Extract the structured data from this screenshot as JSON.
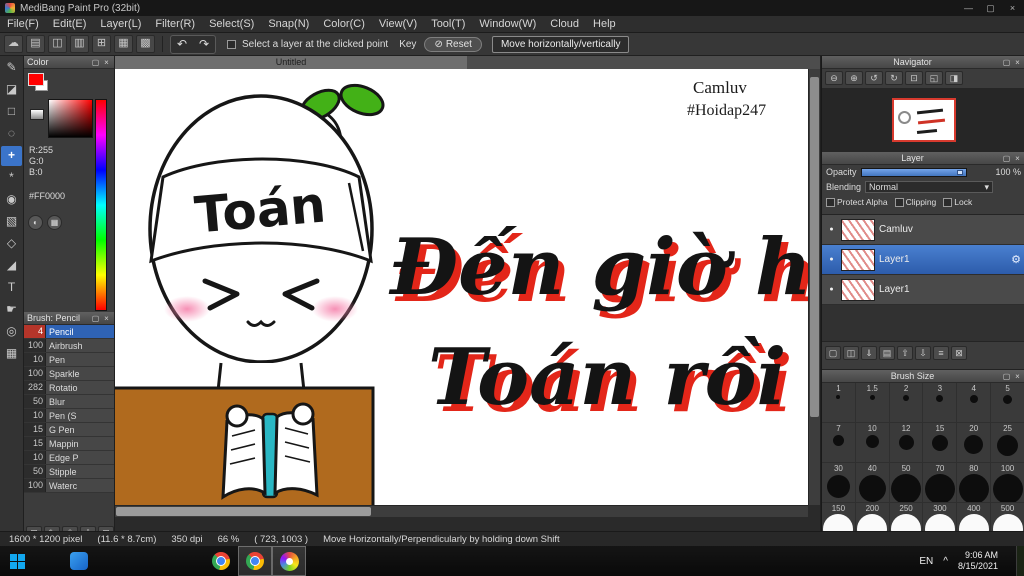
{
  "ui": {
    "float_icon": "▢",
    "close_icon": "×"
  },
  "titlebar": {
    "title": "MediBang Paint Pro (32bit)",
    "minimize": "—",
    "maximize": "▢",
    "close": "×"
  },
  "menu": {
    "items": [
      "File(F)",
      "Edit(E)",
      "Layer(L)",
      "Filter(R)",
      "Select(S)",
      "Snap(N)",
      "Color(C)",
      "View(V)",
      "Tool(T)",
      "Window(W)",
      "Cloud",
      "Help"
    ]
  },
  "toolbar": {
    "icons": [
      {
        "name": "cloud",
        "glyph": "☁"
      },
      {
        "name": "save",
        "glyph": "▤"
      },
      {
        "name": "open",
        "glyph": "◫"
      },
      {
        "name": "comment",
        "glyph": "▥"
      },
      {
        "name": "panel",
        "glyph": "⊞"
      },
      {
        "name": "grid",
        "glyph": "▦"
      },
      {
        "name": "material",
        "glyph": "▩"
      }
    ],
    "undo": "↶",
    "redo": "↷",
    "select_layer_label": "Select a layer at the clicked point",
    "key_label": "Key",
    "reset_icon": "⊘",
    "reset_label": "Reset",
    "move_label": "Move horizontally/vertically"
  },
  "tools": [
    {
      "name": "brush",
      "glyph": "✎"
    },
    {
      "name": "eraser",
      "glyph": "◪"
    },
    {
      "name": "select-rect",
      "glyph": "□"
    },
    {
      "name": "lasso",
      "glyph": "◌"
    },
    {
      "name": "move",
      "glyph": "+"
    },
    {
      "name": "magic-wand",
      "glyph": "*"
    },
    {
      "name": "fill-bucket",
      "glyph": "◉"
    },
    {
      "name": "gradient",
      "glyph": "▧"
    },
    {
      "name": "shape",
      "glyph": "◇"
    },
    {
      "name": "eyedropper",
      "glyph": "◢"
    },
    {
      "name": "text",
      "glyph": "T"
    },
    {
      "name": "pan",
      "glyph": "☛"
    },
    {
      "name": "zoom",
      "glyph": "◎"
    },
    {
      "name": "divide",
      "glyph": "▦"
    }
  ],
  "color_panel": {
    "title": "Color",
    "r": "R:255",
    "g": "G:0",
    "b": "B:0",
    "hex": "#FF0000",
    "btn1": "◐",
    "btn2": "▦"
  },
  "brush_panel": {
    "title": "Brush: Pencil",
    "items": [
      {
        "size": "4",
        "name": "Pencil"
      },
      {
        "size": "100",
        "name": "Airbrush"
      },
      {
        "size": "10",
        "name": "Pen"
      },
      {
        "size": "100",
        "name": "Sparkle"
      },
      {
        "size": "282",
        "name": "Rotatio"
      },
      {
        "size": "50",
        "name": "Blur"
      },
      {
        "size": "10",
        "name": "Pen (S"
      },
      {
        "size": "15",
        "name": "G Pen"
      },
      {
        "size": "15",
        "name": "Mappin"
      },
      {
        "size": "10",
        "name": "Edge P"
      },
      {
        "size": "50",
        "name": "Stipple"
      },
      {
        "size": "100",
        "name": "Waterc"
      }
    ],
    "footer": [
      {
        "name": "add-brush",
        "glyph": "⊞"
      },
      {
        "name": "edit-brush",
        "glyph": "✎"
      },
      {
        "name": "brush-up",
        "glyph": "⇧"
      },
      {
        "name": "brush-down",
        "glyph": "⇩"
      },
      {
        "name": "delete-brush",
        "glyph": "⊠"
      }
    ]
  },
  "canvas": {
    "tab": "Untitled",
    "signature": "Camluv",
    "hashtag": "#Hoidap247",
    "bandage": "Toán",
    "line1": "Đến giờ học",
    "line2": "Toán rồi",
    "colors": {
      "desk": "#b06a1e",
      "sprout": "#43b117",
      "spine": "#2ab7c4",
      "blush": "#f584ad",
      "shadow": "#e32619"
    }
  },
  "navigator": {
    "title": "Navigator",
    "buttons": [
      {
        "name": "zoom-out",
        "glyph": "⊖"
      },
      {
        "name": "zoom-in",
        "glyph": "⊕"
      },
      {
        "name": "rotate-left",
        "glyph": "↺"
      },
      {
        "name": "rotate-right",
        "glyph": "↻"
      },
      {
        "name": "reset-view",
        "glyph": "⊡"
      },
      {
        "name": "fit-window",
        "glyph": "◱"
      },
      {
        "name": "flip-view",
        "glyph": "◨"
      }
    ]
  },
  "layer_panel": {
    "title": "Layer",
    "opacity_label": "Opacity",
    "opacity_value": "100 %",
    "blending_label": "Blending",
    "blending_value": "Normal",
    "dropdown_arrow": "▾",
    "checks": [
      "Protect Alpha",
      "Clipping",
      "Lock"
    ],
    "eye_icon": "●",
    "gear_icon": "⚙",
    "layers": [
      {
        "name": "Camluv"
      },
      {
        "name": "Layer1"
      },
      {
        "name": "Layer1"
      }
    ],
    "buttons": [
      {
        "name": "new-layer",
        "glyph": "▢"
      },
      {
        "name": "duplicate-layer",
        "glyph": "◫"
      },
      {
        "name": "merge-down",
        "glyph": "⇓"
      },
      {
        "name": "new-folder",
        "glyph": "▤"
      },
      {
        "name": "move-layer-up",
        "glyph": "⇧"
      },
      {
        "name": "move-layer-down",
        "glyph": "⇩"
      },
      {
        "name": "layer-settings",
        "glyph": "≡"
      },
      {
        "name": "delete-layer",
        "glyph": "⊠"
      }
    ]
  },
  "brush_size_panel": {
    "title": "Brush Size",
    "sizes": [
      1,
      1.5,
      2,
      3,
      4,
      5,
      7,
      10,
      12,
      15,
      20,
      25,
      30,
      40,
      50,
      70,
      80,
      100,
      150,
      200,
      250,
      300,
      400,
      500
    ]
  },
  "status_bar": {
    "dimensions": "1600 * 1200 pixel",
    "size_cm": "(11.6 * 8.7cm)",
    "dpi": "350 dpi",
    "zoom": "66 %",
    "coords": "( 723, 1003 )",
    "hint": "Move Horizontally/Perpendicularly by holding down Shift"
  },
  "taskbar": {
    "lang": "EN",
    "tray_arrow": "^",
    "time": "9:06 AM",
    "date": "8/15/2021"
  }
}
